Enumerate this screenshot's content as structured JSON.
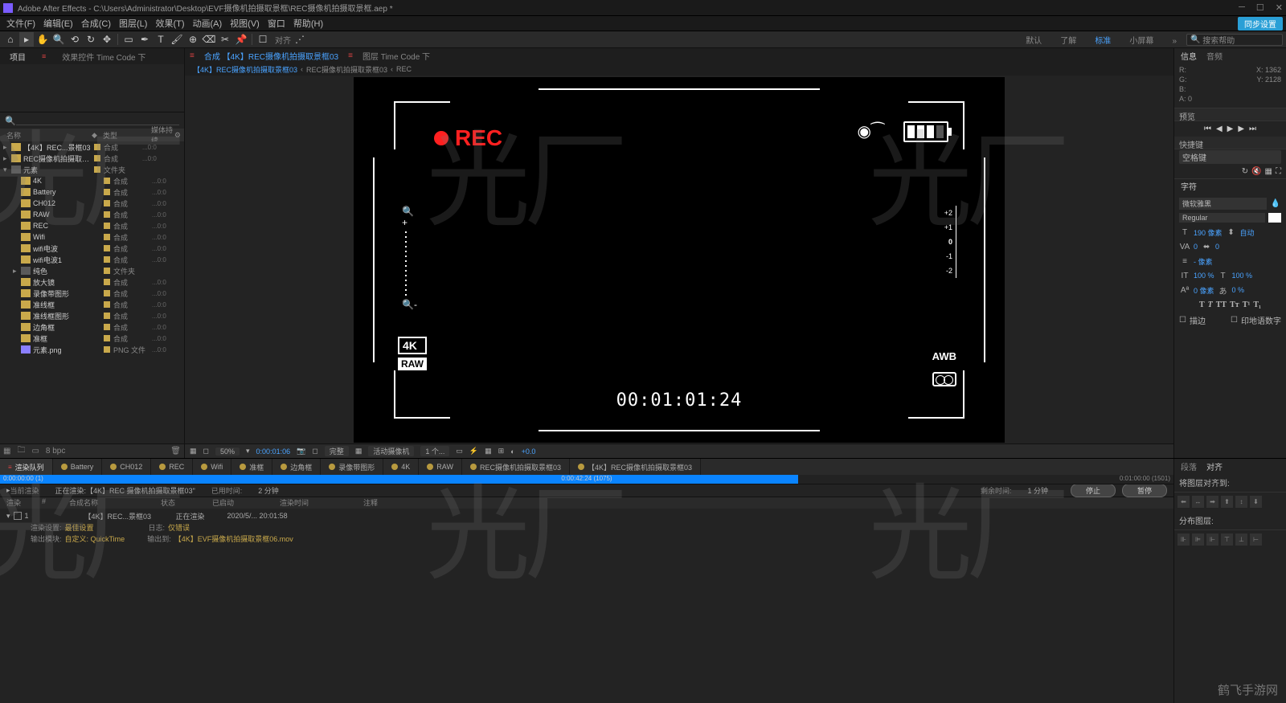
{
  "app": {
    "title": "Adobe After Effects - C:\\Users\\Administrator\\Desktop\\EVF摄像机拍摄取景框\\REC摄像机拍摄取景框.aep *"
  },
  "menu": [
    "文件(F)",
    "编辑(E)",
    "合成(C)",
    "图层(L)",
    "效果(T)",
    "动画(A)",
    "视图(V)",
    "窗口",
    "帮助(H)"
  ],
  "cloud_badge": "同步设置",
  "toolbar": {
    "snapping_label": "对齐",
    "right_links": [
      "默认",
      "了解",
      "标准",
      "小屏幕"
    ],
    "search_placeholder": "搜索帮助"
  },
  "project": {
    "tabs": [
      "项目",
      "效果控件 Time Code 下"
    ],
    "search": "",
    "columns": [
      "名称",
      "类型",
      "媒体持续"
    ],
    "items": [
      {
        "indent": 0,
        "arrow": "▸",
        "icon": "comp",
        "name": "【4K】REC...景框03",
        "type": "合成",
        "size": "...0:0"
      },
      {
        "indent": 0,
        "arrow": "▸",
        "icon": "comp",
        "name": "REC摄像机拍摄取景框03",
        "type": "合成",
        "size": "...0:0"
      },
      {
        "indent": 0,
        "arrow": "▾",
        "icon": "folder",
        "name": "元素",
        "type": "文件夹",
        "size": ""
      },
      {
        "indent": 1,
        "arrow": "",
        "icon": "comp",
        "name": "4K",
        "type": "合成",
        "size": "...0:0"
      },
      {
        "indent": 1,
        "arrow": "",
        "icon": "comp",
        "name": "Battery",
        "type": "合成",
        "size": "...0:0"
      },
      {
        "indent": 1,
        "arrow": "",
        "icon": "comp",
        "name": "CH012",
        "type": "合成",
        "size": "...0:0"
      },
      {
        "indent": 1,
        "arrow": "",
        "icon": "comp",
        "name": "RAW",
        "type": "合成",
        "size": "...0:0"
      },
      {
        "indent": 1,
        "arrow": "",
        "icon": "comp",
        "name": "REC",
        "type": "合成",
        "size": "...0:0"
      },
      {
        "indent": 1,
        "arrow": "",
        "icon": "comp",
        "name": "Wifi",
        "type": "合成",
        "size": "...0:0"
      },
      {
        "indent": 1,
        "arrow": "",
        "icon": "comp",
        "name": "wifi电波",
        "type": "合成",
        "size": "...0:0"
      },
      {
        "indent": 1,
        "arrow": "",
        "icon": "comp",
        "name": "wifi电波1",
        "type": "合成",
        "size": "...0:0"
      },
      {
        "indent": 1,
        "arrow": "▸",
        "icon": "folder",
        "name": "纯色",
        "type": "文件夹",
        "size": ""
      },
      {
        "indent": 1,
        "arrow": "",
        "icon": "comp",
        "name": "放大镜",
        "type": "合成",
        "size": "...0:0"
      },
      {
        "indent": 1,
        "arrow": "",
        "icon": "comp",
        "name": "录像带图形",
        "type": "合成",
        "size": "...0:0"
      },
      {
        "indent": 1,
        "arrow": "",
        "icon": "comp",
        "name": "准线框",
        "type": "合成",
        "size": "...0:0"
      },
      {
        "indent": 1,
        "arrow": "",
        "icon": "comp",
        "name": "准线框图形",
        "type": "合成",
        "size": "...0:0"
      },
      {
        "indent": 1,
        "arrow": "",
        "icon": "comp",
        "name": "边角框",
        "type": "合成",
        "size": "...0:0"
      },
      {
        "indent": 1,
        "arrow": "",
        "icon": "comp",
        "name": "准框",
        "type": "合成",
        "size": "...0:0"
      },
      {
        "indent": 1,
        "arrow": "",
        "icon": "png",
        "name": "元素.png",
        "type": "PNG 文件",
        "size": "...0:0"
      }
    ],
    "footer_bpc": "8 bpc"
  },
  "viewer": {
    "tabs": [
      {
        "label": "合成 【4K】REC摄像机拍摄取景框03",
        "active": true
      },
      {
        "label": "图层 Time Code 下",
        "active": false
      }
    ],
    "breadcrumbs": [
      "【4K】REC摄像机拍摄取景框03",
      "‹",
      "REC摄像机拍摄取景框03",
      "‹",
      "REC"
    ],
    "canvas": {
      "rec_label": "REC",
      "timecode": "00:01:01:24",
      "res": "4K",
      "raw": "RAW",
      "awb": "AWB",
      "exposure_ticks": [
        "+2",
        "+1",
        "0",
        "-1",
        "-2"
      ]
    },
    "controls": {
      "zoom": "50%",
      "timecode": "0:00:01:06",
      "quality": "完整",
      "camera": "活动摄像机",
      "views": "1 个...",
      "exposure": "+0.0"
    }
  },
  "right": {
    "info_tabs": [
      "信息",
      "音频"
    ],
    "info": {
      "R": "",
      "X": "X: 1362",
      "G": "",
      "Y": "Y: 2128",
      "B": "",
      "A": "A: 0"
    },
    "preview_title": "预览",
    "shortcut_title": "快捷键",
    "shortcut_value": "空格键",
    "char_tab": "字符",
    "align_tab": "对齐",
    "font": "微软雅黑",
    "font_style": "Regular",
    "font_size": "190 像素",
    "leading": "自动",
    "kerning": "0",
    "tracking": "0",
    "vscale": "100 %",
    "hscale": "100 %",
    "baseline": "0 像素",
    "tsume": "0 %",
    "stroke_label": "描边",
    "hindi_label": "印地语数字"
  },
  "timeline": {
    "tabs": [
      {
        "label": "渲染队列",
        "color": "",
        "active": true
      },
      {
        "label": "Battery",
        "color": "#b89a3f"
      },
      {
        "label": "CH012",
        "color": "#b89a3f"
      },
      {
        "label": "REC",
        "color": "#b89a3f"
      },
      {
        "label": "Wifi",
        "color": "#b89a3f"
      },
      {
        "label": "准框",
        "color": "#b89a3f"
      },
      {
        "label": "边角框",
        "color": "#b89a3f"
      },
      {
        "label": "录像带图形",
        "color": "#b89a3f"
      },
      {
        "label": "4K",
        "color": "#b89a3f"
      },
      {
        "label": "RAW",
        "color": "#b89a3f"
      },
      {
        "label": "REC摄像机拍摄取景框03",
        "color": "#b89a3f"
      },
      {
        "label": "【4K】REC摄像机拍摄取景框03",
        "color": "#b89a3f"
      }
    ],
    "progress": {
      "percent": 68,
      "left": "0:00:00:00 (1)",
      "mid": "0:00:42:24 (1075)",
      "right": "0:01:00:00 (1501)"
    },
    "status_row": {
      "current": "当前渲染",
      "rendering": "正在渲染:【4K】REC 摄像机拍摄取景框03\"",
      "elapsed_label": "已用时间:",
      "elapsed": "2 分钟",
      "remain_label": "剩余时间:",
      "remain": "1 分钟",
      "btn_stop": "停止",
      "btn_pause": "暂停"
    },
    "columns": [
      "渲染",
      "#",
      "合成名称",
      "状态",
      "已启动",
      "渲染时间",
      "注释"
    ],
    "item": {
      "num": "1",
      "name": "【4K】REC...景框03",
      "status": "正在渲染",
      "started": "2020/5/...  20:01:58",
      "render_settings_label": "渲染设置:",
      "render_settings": "最佳设置",
      "log_label": "日志:",
      "log": "仅错误",
      "output_module_label": "输出模块:",
      "output_module": "自定义: QuickTime",
      "output_to_label": "输出到:",
      "output_to": "【4K】EVF摄像机拍摄取景框06.mov"
    }
  },
  "bottom_right": {
    "tabs": [
      "段落",
      "对齐"
    ],
    "align_label": "将图层对齐到:",
    "distribute_label": "分布图层:"
  },
  "watermark": "光厂",
  "watermark_site": "鹤飞手游网"
}
